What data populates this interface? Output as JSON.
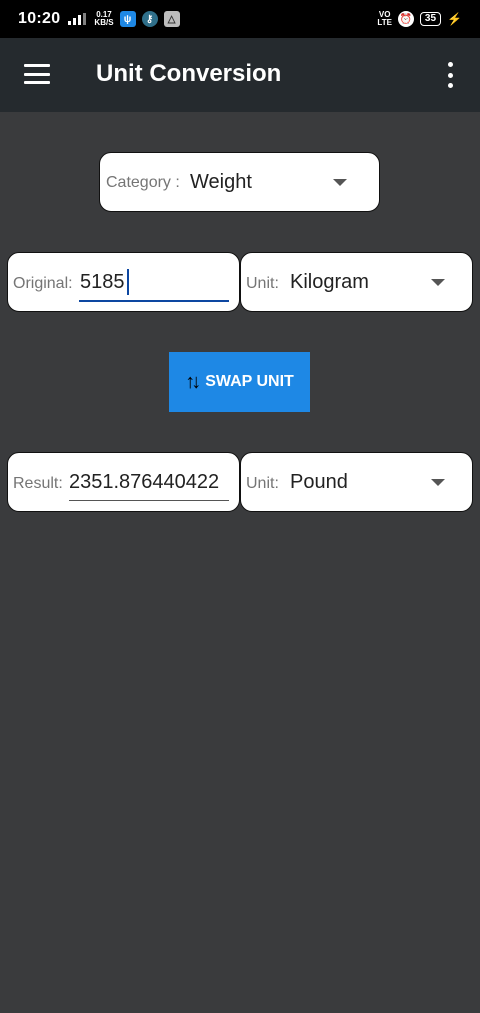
{
  "status_bar": {
    "time": "10:20",
    "net_speed_value": "0.17",
    "net_speed_unit": "KB/S",
    "volte_top": "VO",
    "volte_bottom": "LTE",
    "battery": "35"
  },
  "app_bar": {
    "title": "Unit Conversion"
  },
  "category": {
    "label": "Category :",
    "value": "Weight"
  },
  "original": {
    "label": "Original:",
    "value": "5185",
    "unit_label": "Unit:",
    "unit_value": "Kilogram"
  },
  "swap": {
    "label": "SWAP UNIT"
  },
  "result": {
    "label": "Result:",
    "value": "2351.876440422",
    "unit_label": "Unit:",
    "unit_value": "Pound"
  },
  "colors": {
    "accent": "#1e88e5",
    "background": "#3a3b3d",
    "app_bar": "#252a2e"
  }
}
